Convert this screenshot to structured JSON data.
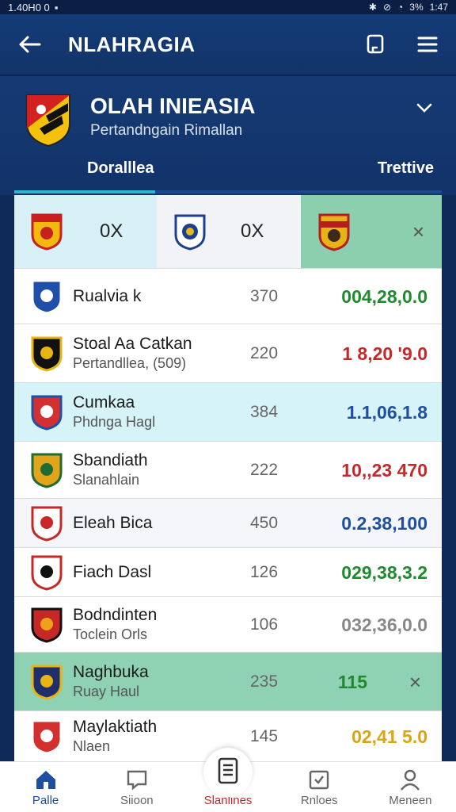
{
  "status_bar": {
    "left_text": "1.40H0 0",
    "battery": "3%",
    "time": "1:47"
  },
  "app_bar": {
    "title": "NLAHRAGIA"
  },
  "header": {
    "league_title": "OLAH INIEASIA",
    "league_subtitle": "Pertandngain Rimallan",
    "tab_left": "Doralllea",
    "tab_right": "Trettive"
  },
  "top_match": {
    "home_score": "0X",
    "away_score": "0X",
    "close_label": "×"
  },
  "rows": [
    {
      "name": "Rualvia k",
      "sub": "",
      "num": "370",
      "value": "004,28,0.0",
      "value_color": "#1f8a2e",
      "bg": "#ffffff"
    },
    {
      "name": "Stoal Aa Catkan",
      "sub": "Pertandllea, (509)",
      "num": "220",
      "value": "1 8,20 '9.0",
      "value_color": "#c62828",
      "bg": "#ffffff"
    },
    {
      "name": "Cumkaa",
      "sub": "Phdnga Hagl",
      "num": "384",
      "value": "1.1,06,1.8",
      "value_color": "#1e4fa1",
      "bg": "#d6f3f8"
    },
    {
      "name": "Sbandiath",
      "sub": "Slanahlain",
      "num": "222",
      "value": "10,,23 470",
      "value_color": "#c62828",
      "bg": "#ffffff"
    },
    {
      "name": "Eleah Bica",
      "sub": "",
      "num": "450",
      "value": "0.2,38,100",
      "value_color": "#1e4fa1",
      "bg": "#f4f6f9"
    },
    {
      "name": "Fiach Dasl",
      "sub": "",
      "num": "126",
      "value": "029,38,3.2",
      "value_color": "#1f8a2e",
      "bg": "#ffffff"
    },
    {
      "name": "Bodndinten",
      "sub": "Toclein Orls",
      "num": "106",
      "value": "032,36,0.0",
      "value_color": "#888888",
      "bg": "#ffffff"
    },
    {
      "name": "Naghbuka",
      "sub": "Ruay Haul",
      "num": "235",
      "value": "115",
      "value_color": "#1f8a2e",
      "bg": "#8fd2b3",
      "close": "×"
    },
    {
      "name": "Maylaktiath",
      "sub": "Nlaen",
      "num": "145",
      "value": "02,41 5.0",
      "value_color": "#d9a514",
      "bg": "#ffffff"
    }
  ],
  "bottom_nav": [
    {
      "label": "Palle"
    },
    {
      "label": "Siioon"
    },
    {
      "label": "Slanlines"
    },
    {
      "label": "Rnloes"
    },
    {
      "label": "Meneen"
    }
  ],
  "colors": {
    "primary": "#143b78",
    "accent": "#2bb7c9",
    "green": "#1f8a2e",
    "red": "#c62828",
    "blue": "#1e4fa1"
  }
}
